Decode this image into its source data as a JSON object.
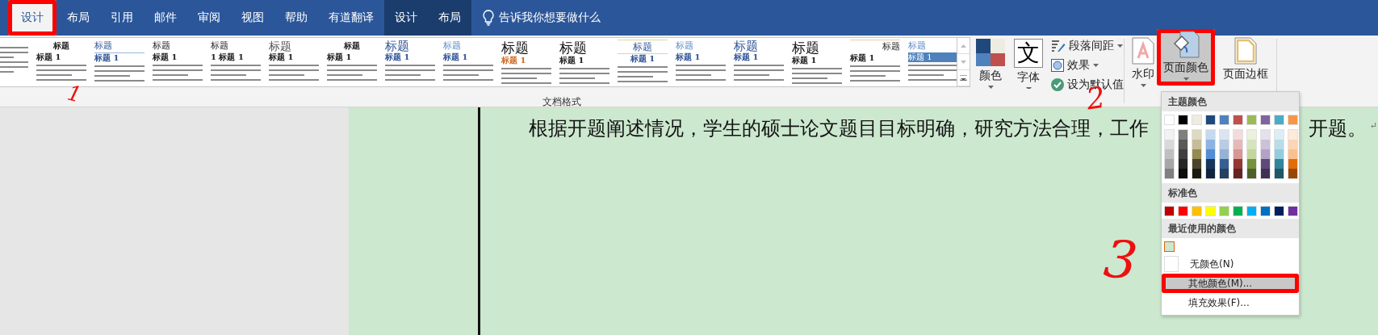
{
  "tabs": [
    {
      "label": "设计",
      "selected": true,
      "contextual": false,
      "annotated": true
    },
    {
      "label": "布局",
      "selected": false,
      "contextual": false,
      "annotated": false
    },
    {
      "label": "引用",
      "selected": false,
      "contextual": false,
      "annotated": false
    },
    {
      "label": "邮件",
      "selected": false,
      "contextual": false,
      "annotated": false
    },
    {
      "label": "审阅",
      "selected": false,
      "contextual": false,
      "annotated": false
    },
    {
      "label": "视图",
      "selected": false,
      "contextual": false,
      "annotated": false
    },
    {
      "label": "帮助",
      "selected": false,
      "contextual": false,
      "annotated": false
    },
    {
      "label": "有道翻译",
      "selected": false,
      "contextual": false,
      "annotated": false
    },
    {
      "label": "设计",
      "selected": false,
      "contextual": true,
      "annotated": false
    },
    {
      "label": "布局",
      "selected": false,
      "contextual": true,
      "annotated": false
    }
  ],
  "tell_me": "告诉我你想要做什么",
  "style_gallery": {
    "label": "文档格式",
    "thumbnails": [
      {
        "kind": "body"
      },
      {
        "kind": "center",
        "title": "标题",
        "heading": "标题 1"
      },
      {
        "kind": "blue-rule",
        "title": "标题",
        "heading": "标题 1"
      },
      {
        "kind": "basic",
        "title": "标题",
        "heading": "标题 1"
      },
      {
        "kind": "basic",
        "title": "标题",
        "heading": "1 标题 1"
      },
      {
        "kind": "gray-large",
        "title": "标题",
        "heading": "标题 1"
      },
      {
        "kind": "center",
        "title": "标题",
        "heading": "标题 1"
      },
      {
        "kind": "blue-large",
        "title": "标题",
        "heading": "标题 1"
      },
      {
        "kind": "blue-light",
        "title": "标题",
        "heading": "标题 1"
      },
      {
        "kind": "large-accent",
        "title": "标题",
        "heading": "标题 1"
      },
      {
        "kind": "large",
        "title": "标题",
        "heading": "标题 1"
      },
      {
        "kind": "blue-rule-center",
        "title": "标题",
        "heading": "标题 1"
      },
      {
        "kind": "blue-light",
        "title": "标题",
        "heading": "标题 1"
      },
      {
        "kind": "blue-large",
        "title": "标题",
        "heading": "标题 1"
      },
      {
        "kind": "large",
        "title": "标题",
        "heading": "标题 1"
      },
      {
        "kind": "right",
        "title": "标题",
        "heading": "标题 1"
      },
      {
        "kind": "bar",
        "title": "标题",
        "heading": "标题 1"
      }
    ]
  },
  "colors_button": "颜色",
  "fonts_button": {
    "glyph": "文",
    "label": "字体"
  },
  "paragraph_spacing": "段落间距",
  "effects": "效果",
  "set_default": "设为默认值",
  "watermark_button": "水印",
  "page_color_button": {
    "label": "页面颜色",
    "selected": true,
    "annotated": true
  },
  "page_borders_button": "页面边框",
  "document": {
    "text_before": "根据开题阐述情况，学生的硕士论文题目目标明确，研究方法合理，工作",
    "text_after": "开题。",
    "paragraph_mark": "↵"
  },
  "page_color_menu": {
    "theme_title": "主题颜色",
    "theme_colors": [
      {
        "color": "#ffffff",
        "shades": [
          {
            "color": "#f2f2f2"
          },
          {
            "color": "#d9d9d9"
          },
          {
            "color": "#bfbfbf"
          },
          {
            "color": "#a6a6a6"
          },
          {
            "color": "#808080"
          }
        ]
      },
      {
        "color": "#000000",
        "shades": [
          {
            "color": "#7f7f7f"
          },
          {
            "color": "#595959"
          },
          {
            "color": "#404040"
          },
          {
            "color": "#262626"
          },
          {
            "color": "#0d0d0d"
          }
        ]
      },
      {
        "color": "#eeece1",
        "shades": [
          {
            "color": "#ddd9c3"
          },
          {
            "color": "#c4bd97"
          },
          {
            "color": "#948a54"
          },
          {
            "color": "#4a452a"
          },
          {
            "color": "#1d1b10"
          }
        ]
      },
      {
        "color": "#1f497d",
        "shades": [
          {
            "color": "#c6d9f0"
          },
          {
            "color": "#8db3e2"
          },
          {
            "color": "#548dd4"
          },
          {
            "color": "#17365d"
          },
          {
            "color": "#0f243e"
          }
        ]
      },
      {
        "color": "#4f81bd",
        "shades": [
          {
            "color": "#dbe5f1"
          },
          {
            "color": "#b8cce4"
          },
          {
            "color": "#95b3d7"
          },
          {
            "color": "#366092"
          },
          {
            "color": "#244061"
          }
        ]
      },
      {
        "color": "#c0504d",
        "shades": [
          {
            "color": "#f2dcdb"
          },
          {
            "color": "#e5b9b7"
          },
          {
            "color": "#d99694"
          },
          {
            "color": "#953734"
          },
          {
            "color": "#632423"
          }
        ]
      },
      {
        "color": "#9bbb59",
        "shades": [
          {
            "color": "#ebf1dd"
          },
          {
            "color": "#d7e3bc"
          },
          {
            "color": "#c3d69b"
          },
          {
            "color": "#76923c"
          },
          {
            "color": "#4f6128"
          }
        ]
      },
      {
        "color": "#8064a2",
        "shades": [
          {
            "color": "#e5e0ec"
          },
          {
            "color": "#ccc1d9"
          },
          {
            "color": "#b2a2c7"
          },
          {
            "color": "#5f497a"
          },
          {
            "color": "#3f3151"
          }
        ]
      },
      {
        "color": "#4bacc6",
        "shades": [
          {
            "color": "#dbeef3"
          },
          {
            "color": "#b7dde8"
          },
          {
            "color": "#92cddc"
          },
          {
            "color": "#31859b"
          },
          {
            "color": "#205867"
          }
        ]
      },
      {
        "color": "#f79646",
        "shades": [
          {
            "color": "#fdeada"
          },
          {
            "color": "#fbd5b5"
          },
          {
            "color": "#fac08f"
          },
          {
            "color": "#e36c09"
          },
          {
            "color": "#974806"
          }
        ]
      }
    ],
    "standard_title": "标准色",
    "standard_colors": [
      {
        "color": "#c00000"
      },
      {
        "color": "#ff0000"
      },
      {
        "color": "#ffc000"
      },
      {
        "color": "#ffff00"
      },
      {
        "color": "#92d050"
      },
      {
        "color": "#00b050"
      },
      {
        "color": "#00b0f0"
      },
      {
        "color": "#0070c0"
      },
      {
        "color": "#002060"
      },
      {
        "color": "#7030a0"
      }
    ],
    "recent_title": "最近使用的颜色",
    "recent_colors": [
      {
        "color": "#cce8cf",
        "selected": true
      }
    ],
    "items": [
      {
        "label": "无颜色(N)",
        "kind": "swatch",
        "selected": false,
        "annotated": false
      },
      {
        "label": "其他颜色(M)...",
        "kind": "plain",
        "selected": true,
        "annotated": true
      },
      {
        "label": "填充效果(F)...",
        "kind": "plain",
        "selected": false,
        "annotated": false
      }
    ]
  },
  "annotation_numbers": [
    "1",
    "2",
    "3"
  ]
}
